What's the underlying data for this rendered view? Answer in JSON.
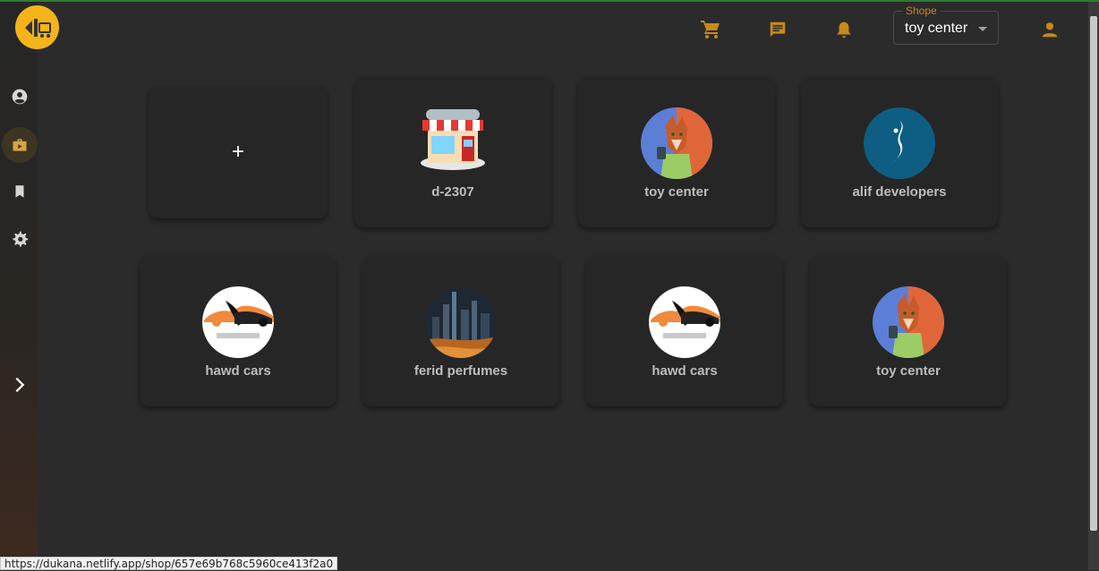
{
  "header": {
    "shop_select": {
      "legend": "Shope",
      "value": "toy center"
    }
  },
  "sidebar": {
    "items": [
      {
        "icon": "account-circle-icon"
      },
      {
        "icon": "store-icon",
        "active": true
      },
      {
        "icon": "bookmark-icon"
      },
      {
        "icon": "settings-icon"
      }
    ],
    "expand_icon": "chevron-right-icon"
  },
  "shops": {
    "add_label": "+",
    "cards": [
      {
        "name": "d-2307",
        "avatar": "storefront"
      },
      {
        "name": "toy center",
        "avatar": "fox"
      },
      {
        "name": "alif developers",
        "avatar": "alif"
      },
      {
        "name": "hawd cars",
        "avatar": "car"
      },
      {
        "name": "ferid perfumes",
        "avatar": "city"
      },
      {
        "name": "hawd cars",
        "avatar": "car"
      },
      {
        "name": "toy center",
        "avatar": "fox"
      }
    ]
  },
  "status_bar": {
    "url": "https://dukana.netlify.app/shop/657e69b768c5960ce413f2a0"
  },
  "colors": {
    "accent": "#c8891b",
    "logo": "#f4b41a",
    "background": "#2b2b2b",
    "card": "#262626"
  }
}
